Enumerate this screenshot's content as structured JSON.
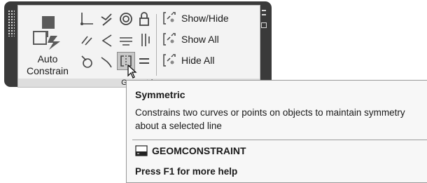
{
  "panel": {
    "footer_label": "Geometric",
    "auto_constrain_label": "Auto Constrain",
    "commands": {
      "show_hide": "Show/Hide",
      "show_all": "Show All",
      "hide_all": "Hide All"
    },
    "tools": [
      "coincident",
      "collinear",
      "concentric",
      "fix",
      "parallel",
      "perpendicular",
      "horizontal",
      "vertical",
      "tangent",
      "smooth",
      "symmetric",
      "equal"
    ],
    "active_tool": "symmetric"
  },
  "tooltip": {
    "title": "Symmetric",
    "description_line1": "Constrains two curves or points on objects to maintain symmetry",
    "description_line2": "about a selected line",
    "command": "GEOMCONSTRAINT",
    "help": "Press F1 for more help"
  }
}
